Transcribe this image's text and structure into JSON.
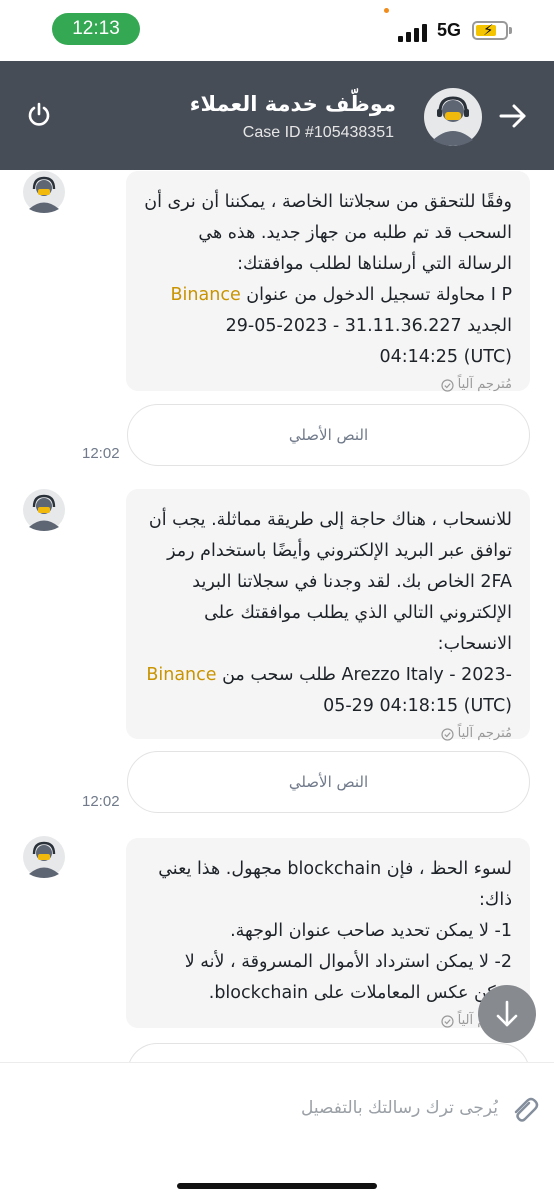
{
  "status_bar": {
    "time": "12:13",
    "network": "5G"
  },
  "header": {
    "title": "موظّف خدمة العملاء",
    "case_id": "Case ID #105438351",
    "icons": {
      "left": "power-icon",
      "right": "arrow-right-icon"
    },
    "background": "#474d57"
  },
  "messages": [
    {
      "paragraphs": [
        "وفقًا للتحقق من سجلاتنا الخاصة ، يمكننا أن نرى أن السحب قد تم طلبه من جهاز جديد. هذه هي الرسالة التي أرسلناها لطلب موافقتك:"
      ],
      "brand_line": {
        "brand": "Binance",
        "text_after_brand": " محاولة تسجيل الدخول من عنوان I P الجديد 31.11.36.227 - 2023-05-29 04:14:25 (UTC)"
      },
      "translated_label": "مُترجم آلياً",
      "original_button": "النص الأصلي",
      "timestamp": "12:02"
    },
    {
      "paragraphs": [
        "للانسحاب ، هناك حاجة إلى طريقة مماثلة. يجب أن توافق عبر البريد الإلكتروني وأيضًا باستخدام رمز 2FA الخاص بك. لقد وجدنا في سجلاتنا البريد الإلكتروني التالي الذي يطلب موافقتك على الانسحاب:"
      ],
      "brand_line": {
        "brand": "Binance",
        "text_after_brand": " طلب سحب من Arezzo Italy - 2023-05-29 04:18:15 (UTC)"
      },
      "translated_label": "مُترجم آلياً",
      "original_button": "النص الأصلي",
      "timestamp": "12:02"
    },
    {
      "paragraphs": [
        "لسوء الحظ ، فإن blockchain مجهول. هذا يعني ذاك:",
        "1- لا يمكن تحديد صاحب عنوان الوجهة.",
        "2- لا يمكن استرداد الأموال المسروقة ، لأنه لا يمكن عكس المعاملات على blockchain."
      ],
      "translated_label": "مُترجم آلياً"
    }
  ],
  "input": {
    "placeholder": "يُرجى ترك رسالتك بالتفصيل"
  },
  "icons": {
    "scroll": "arrow-down-icon",
    "attach": "paperclip-icon",
    "avatar": "support-agent-avatar"
  },
  "colors": {
    "brand": "#c99400",
    "time_pill": "#34a853",
    "bubble": "#f5f5f5"
  }
}
